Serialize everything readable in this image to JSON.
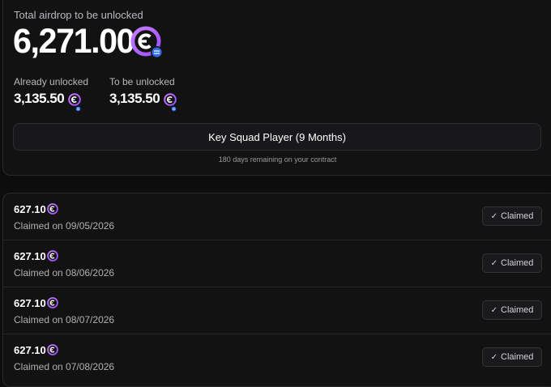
{
  "summary": {
    "total_label": "Total airdrop to be unlocked",
    "total_amount": "6,271.00",
    "unlocked_label": "Already unlocked",
    "unlocked_amount": "3,135.50",
    "locked_label": "To be unlocked",
    "locked_amount": "3,135.50"
  },
  "plan": {
    "button_label": "Key Squad Player (9 Months)",
    "remaining_text": "180 days remaining on your contract"
  },
  "claims": [
    {
      "amount": "627.10",
      "date_text": "Claimed on 09/05/2026",
      "status": "Claimed"
    },
    {
      "amount": "627.10",
      "date_text": "Claimed on 08/06/2026",
      "status": "Claimed"
    },
    {
      "amount": "627.10",
      "date_text": "Claimed on 08/07/2026",
      "status": "Claimed"
    },
    {
      "amount": "627.10",
      "date_text": "Claimed on 07/08/2026",
      "status": "Claimed"
    }
  ],
  "icons": {
    "token": "token-coin-icon",
    "badge": "chain-badge-icon",
    "check": "check-icon"
  },
  "colors": {
    "background": "#0d0d0e",
    "card": "#121213",
    "token_purple": "#b567ff",
    "badge_blue": "#2f6df0"
  }
}
